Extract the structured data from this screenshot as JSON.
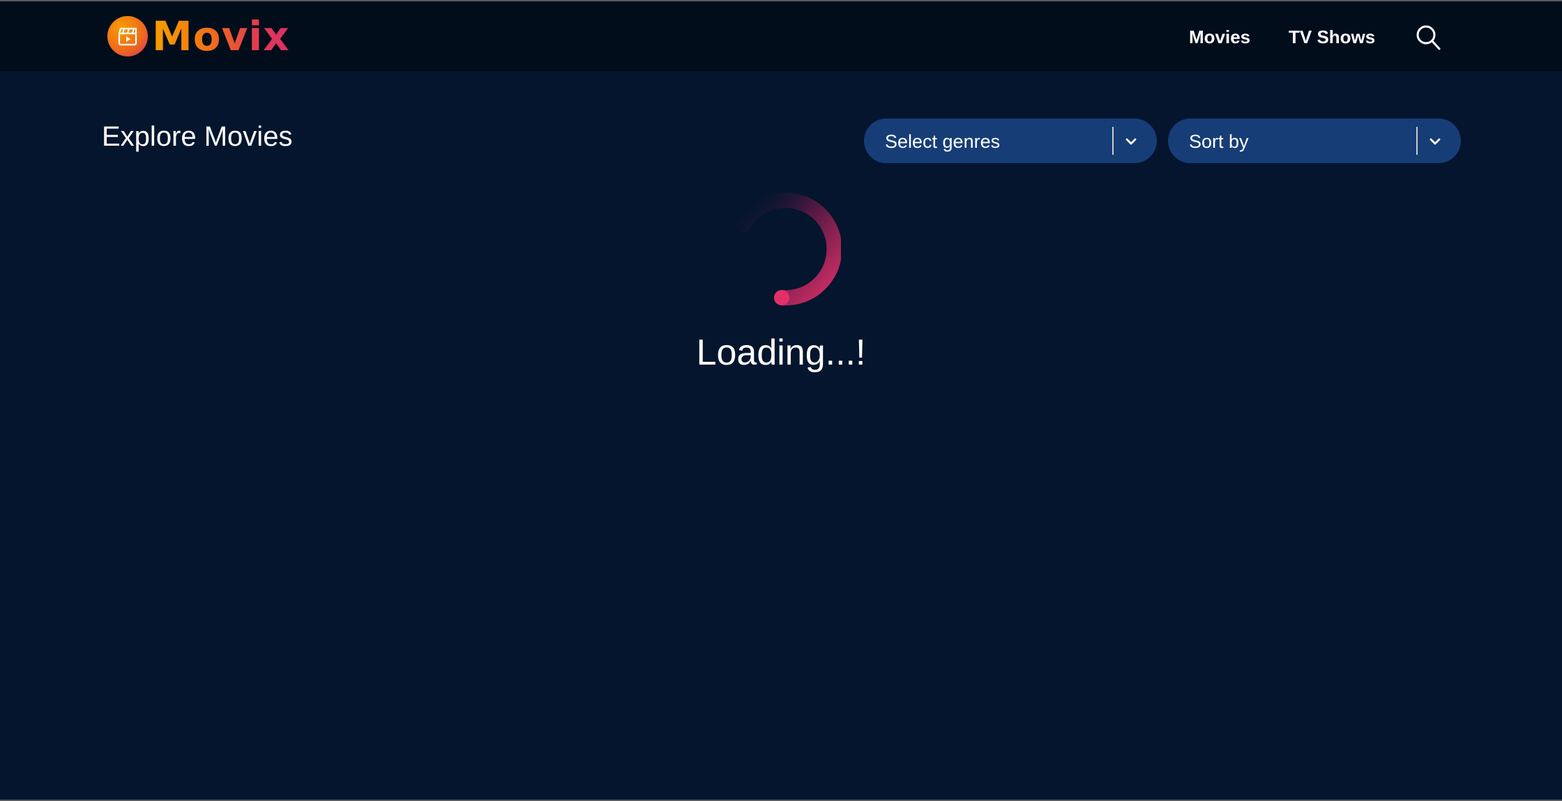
{
  "app": {
    "brand_name": "Movix",
    "logo_icon": "clapperboard-icon"
  },
  "nav": {
    "items": [
      {
        "label": "Movies"
      },
      {
        "label": "TV Shows"
      }
    ],
    "search_icon": "search-icon"
  },
  "main": {
    "title": "Explore Movies",
    "filters": {
      "genres_placeholder": "Select genres",
      "sort_placeholder": "Sort by",
      "chevron_icon": "chevron-down-icon"
    },
    "loading": {
      "text": "Loading...!",
      "spinner_icon": "spinner-icon"
    }
  },
  "colors": {
    "background": "#04152d",
    "header_background": "#020d1c",
    "select_background": "#173d77",
    "brand_orange": "#f89e00",
    "brand_pink": "#da2f68"
  }
}
